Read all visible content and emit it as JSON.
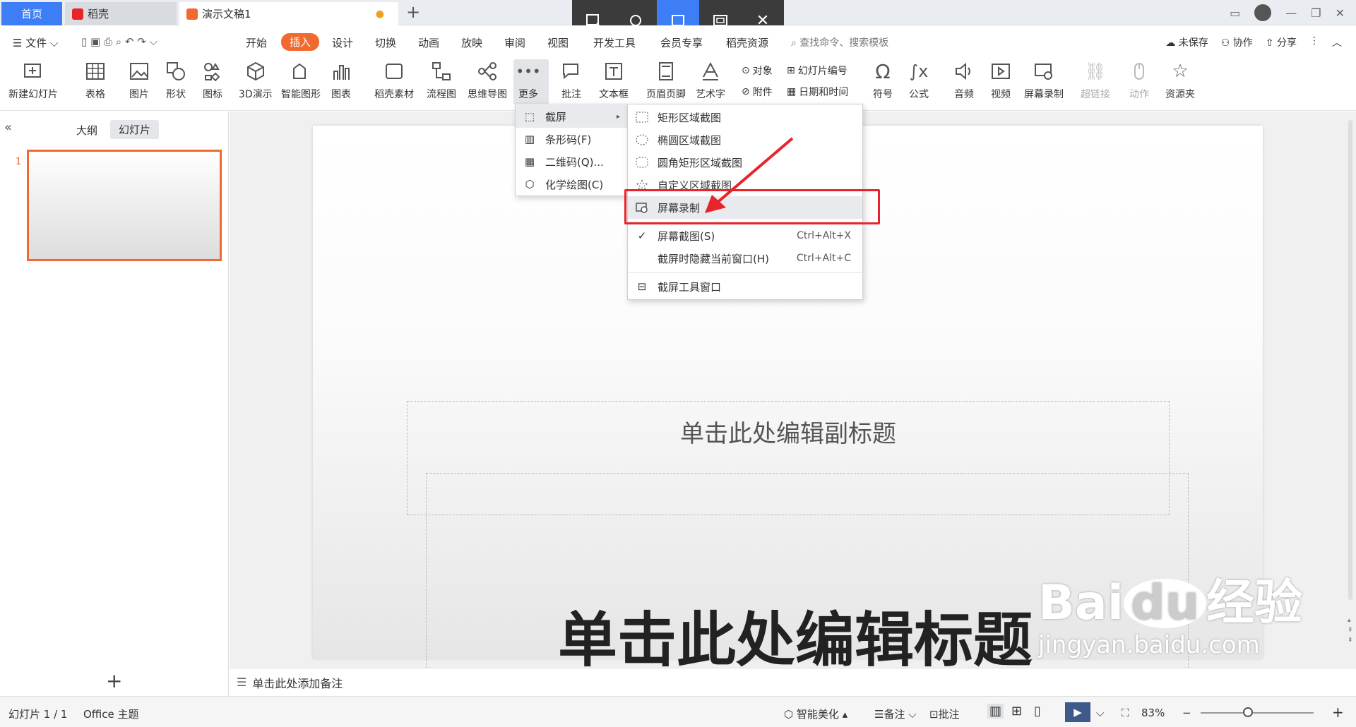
{
  "tabs": {
    "home": "首页",
    "daoke": "稻壳",
    "doc": "演示文稿1",
    "new": "+"
  },
  "menubar": {
    "file": "文件",
    "items": [
      "开始",
      "插入",
      "设计",
      "切换",
      "动画",
      "放映",
      "审阅",
      "视图",
      "开发工具",
      "会员专享",
      "稻壳资源"
    ],
    "search": "查找命令、搜索模板",
    "unsaved": "未保存",
    "collab": "协作",
    "share": "分享"
  },
  "ribbon": {
    "new_slide": "新建幻灯片",
    "table": "表格",
    "picture": "图片",
    "shape": "形状",
    "icon": "图标",
    "d3": "3D演示",
    "smartart": "智能图形",
    "chart": "图表",
    "material": "稻壳素材",
    "flow": "流程图",
    "mindmap": "思维导图",
    "more": "更多",
    "comment": "批注",
    "textbox": "文本框",
    "header": "页眉页脚",
    "arttext": "艺术字",
    "object": "对象",
    "slidenum": "幻灯片编号",
    "attach": "附件",
    "datetime": "日期和时间",
    "symbol": "符号",
    "formula": "公式",
    "audio": "音频",
    "video": "视频",
    "screenrec": "屏幕录制",
    "hyperlink": "超链接",
    "action": "动作",
    "resource": "资源夹"
  },
  "left": {
    "outline": "大纲",
    "slides": "幻灯片",
    "slide_no": "1",
    "add": "+"
  },
  "slide": {
    "subtitle": "单击此处编辑副标题",
    "title": "单击此处编辑标题"
  },
  "notes": "单击此处添加备注",
  "status": {
    "page": "幻灯片 1 / 1",
    "theme": "Office 主题",
    "beautify": "智能美化",
    "notes": "备注",
    "comment": "批注",
    "zoom": "83%"
  },
  "more_menu": [
    "截屏",
    "条形码(F)",
    "二维码(Q)...",
    "化学绘图(C)"
  ],
  "capture_menu": {
    "items": [
      "矩形区域截图",
      "椭圆区域截图",
      "圆角矩形区域截图",
      "自定义区域截图",
      "屏幕录制",
      "屏幕截图(S)",
      "截屏时隐藏当前窗口(H)",
      "截屏工具窗口"
    ],
    "shortcuts": [
      "Ctrl+Alt+X",
      "Ctrl+Alt+C"
    ]
  },
  "watermark": {
    "brand": "Bai",
    "du": "du",
    "suffix": "经验",
    "url": "jingyan.baidu.com"
  }
}
